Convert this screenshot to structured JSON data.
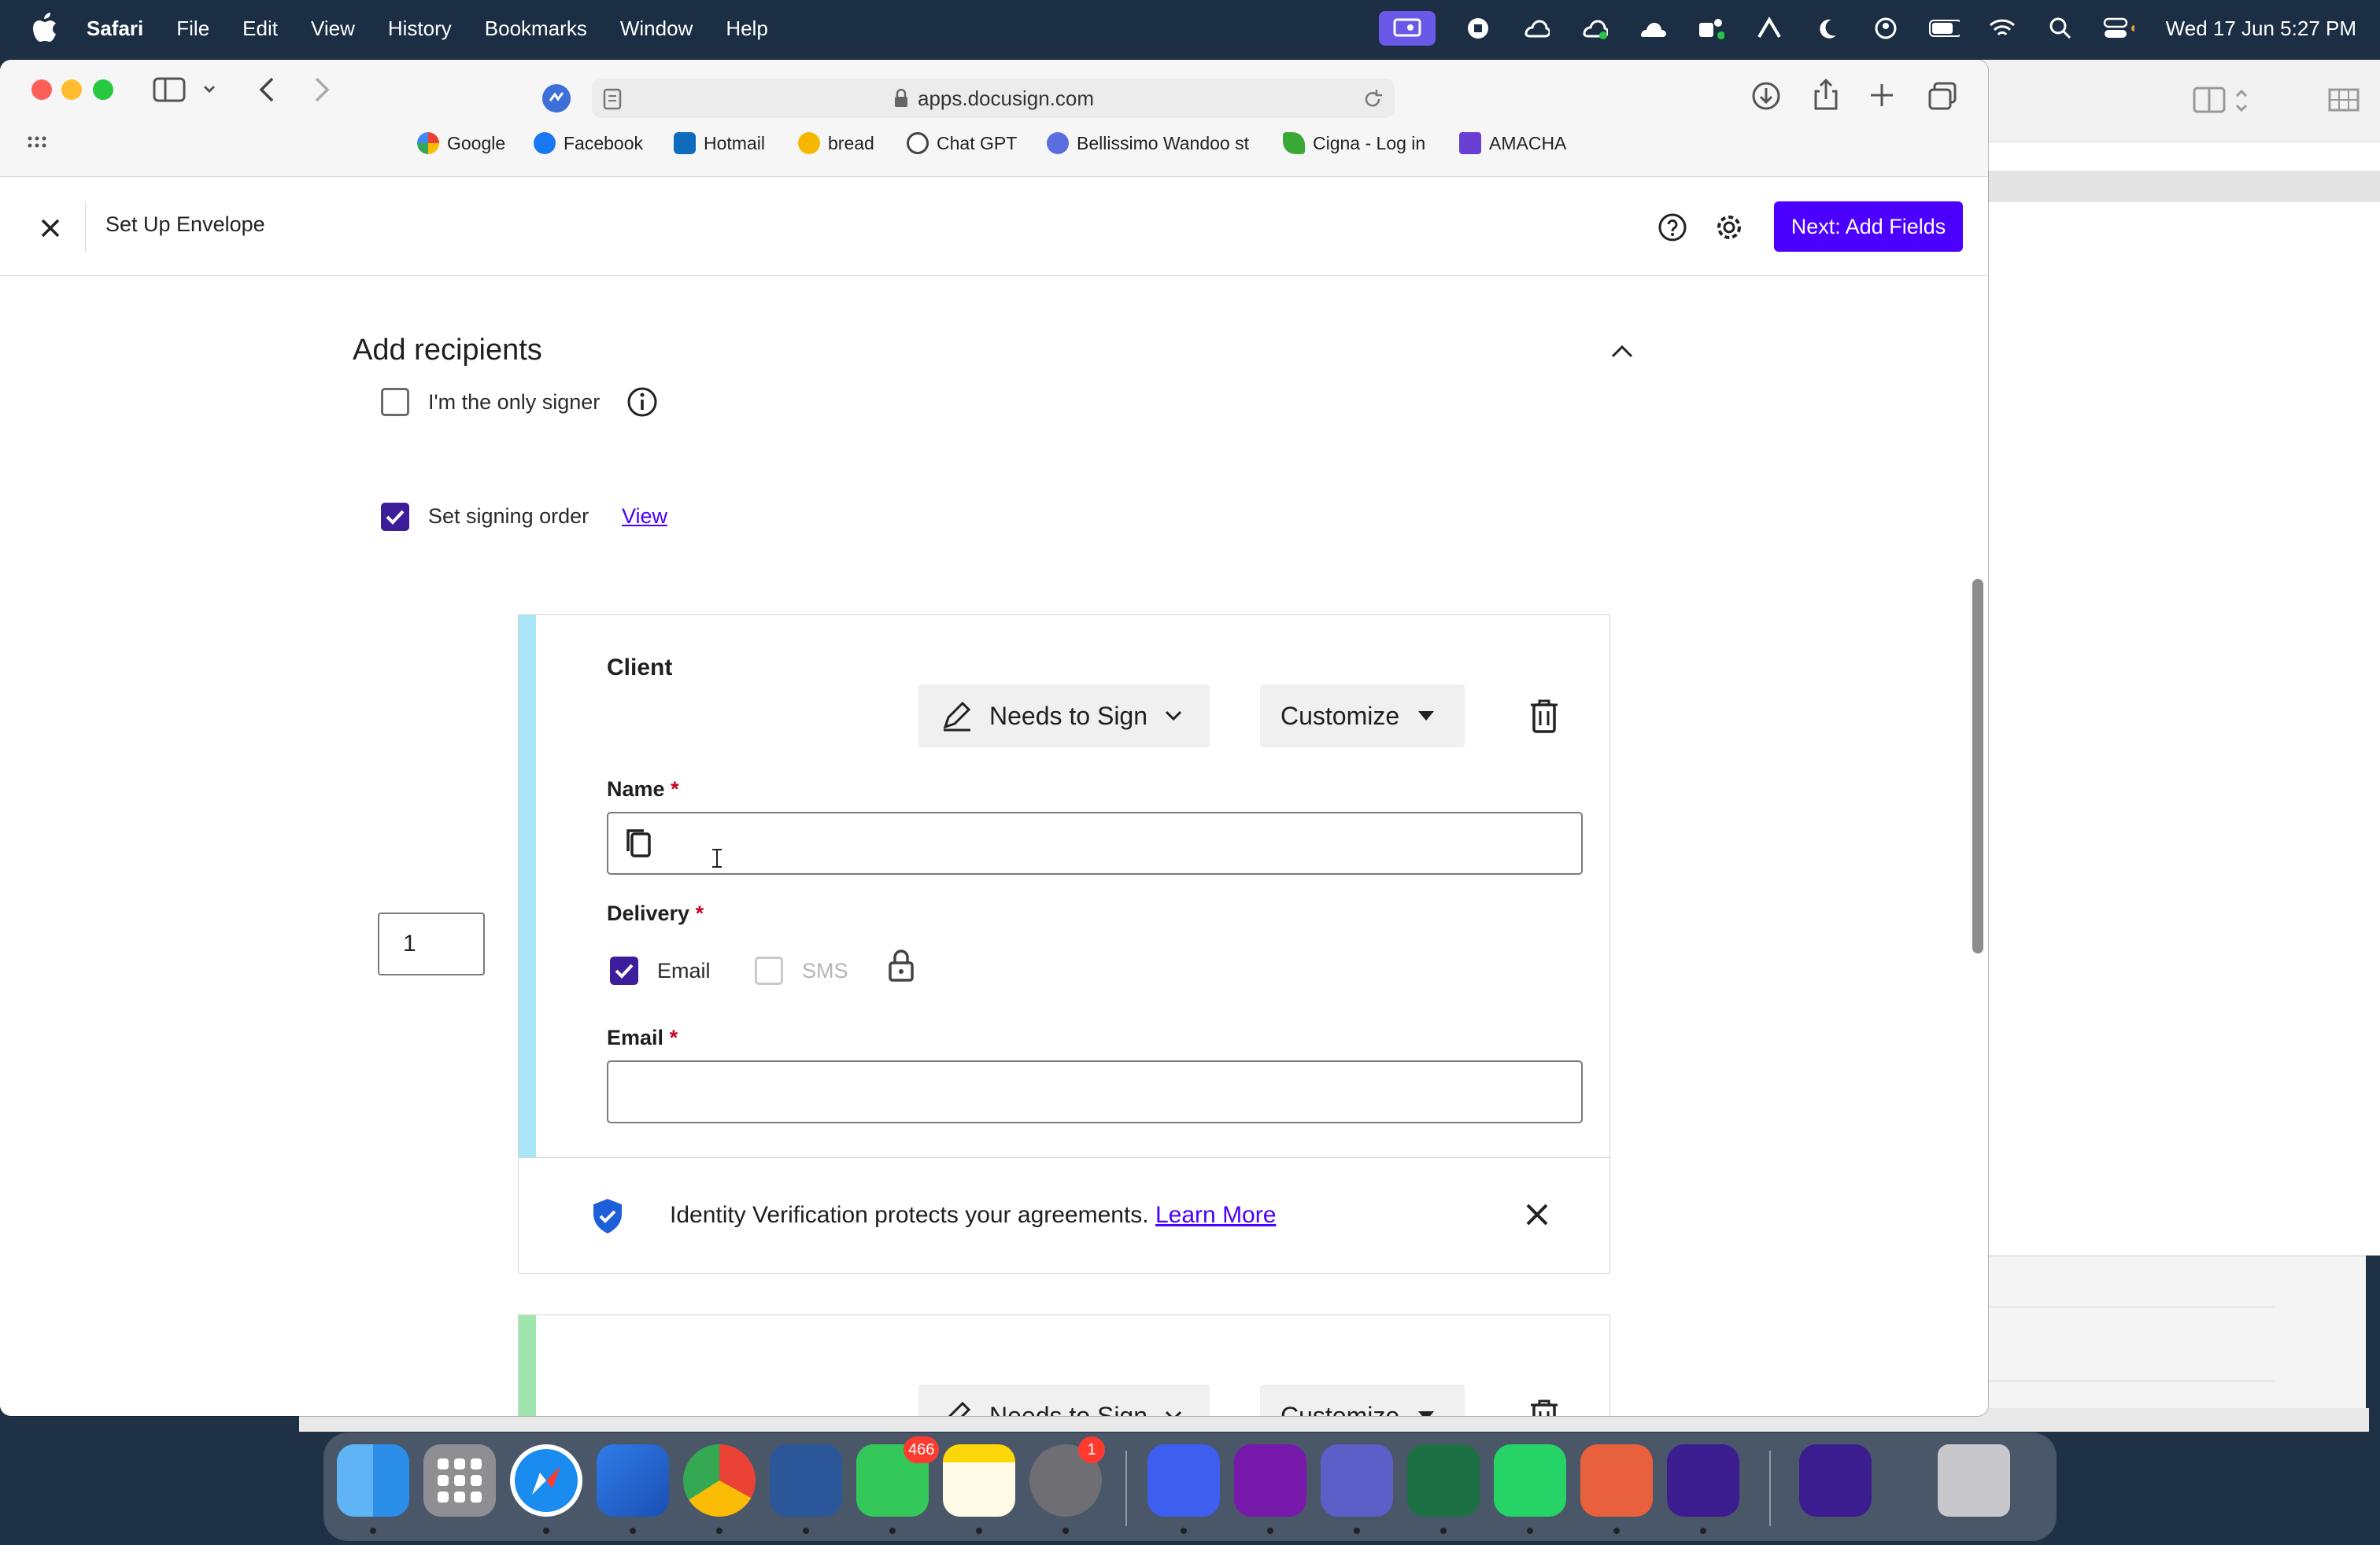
{
  "menubar": {
    "app": "Safari",
    "items": [
      "File",
      "Edit",
      "View",
      "History",
      "Bookmarks",
      "Window",
      "Help"
    ],
    "clock": "Wed 17 Jun  5:27 PM"
  },
  "browser": {
    "url": "apps.docusign.com",
    "bookmarks": [
      {
        "label": "Google",
        "color": "#4285f4"
      },
      {
        "label": "Facebook",
        "color": "#1877f2"
      },
      {
        "label": "Hotmail",
        "color": "#0f6cbd"
      },
      {
        "label": "bread",
        "color": "#f5b700"
      },
      {
        "label": "Chat GPT",
        "color": "#444444"
      },
      {
        "label": "Bellissimo Wandoo st",
        "color": "#5b6ee1"
      },
      {
        "label": "Cigna - Log in",
        "color": "#3aa935"
      },
      {
        "label": "AMACHA",
        "color": "#6b3fd4"
      }
    ]
  },
  "header": {
    "title": "Set Up Envelope",
    "next_button": "Next: Add Fields",
    "accent": "#4c00ff"
  },
  "recipients": {
    "section_title": "Add recipients",
    "only_signer_label": "I'm the only signer",
    "only_signer_checked": false,
    "signing_order_label": "Set signing order",
    "signing_order_checked": true,
    "view_link": "View",
    "card1": {
      "role_name": "Client",
      "order": "1",
      "action": "Needs to Sign",
      "customize": "Customize",
      "name_label": "Name",
      "name_value": "",
      "delivery_label": "Delivery",
      "delivery_email": "Email",
      "delivery_sms": "SMS",
      "email_checked": true,
      "sms_checked": false,
      "email_label": "Email",
      "email_value": "",
      "stripe_color": "#a8e6f8"
    },
    "identity_banner": {
      "text": "Identity Verification protects your agreements.",
      "link": "Learn More"
    },
    "card2": {
      "action": "Needs to Sign",
      "customize": "Customize",
      "stripe_color": "#9ee6ad"
    },
    "required_mark": "*"
  },
  "dock": {
    "messages_badge": "466",
    "settings_badge": "1"
  }
}
